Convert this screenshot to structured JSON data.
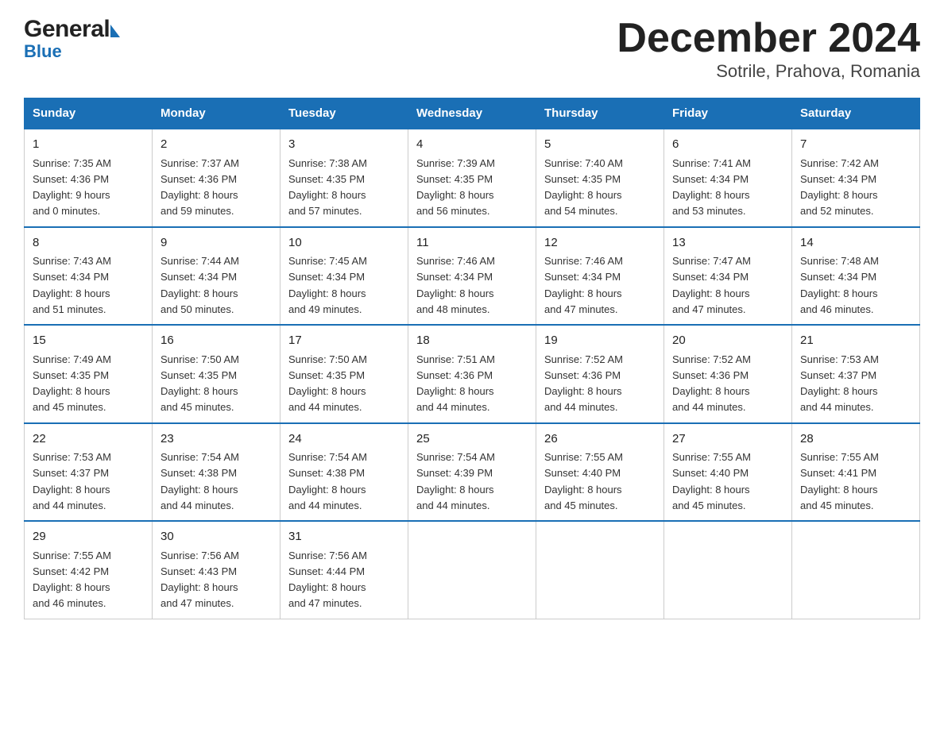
{
  "header": {
    "logo_general": "General",
    "logo_blue": "Blue",
    "title": "December 2024",
    "subtitle": "Sotrile, Prahova, Romania"
  },
  "days_of_week": [
    "Sunday",
    "Monday",
    "Tuesday",
    "Wednesday",
    "Thursday",
    "Friday",
    "Saturday"
  ],
  "weeks": [
    [
      {
        "day": "1",
        "sunrise": "7:35 AM",
        "sunset": "4:36 PM",
        "daylight": "9 hours and 0 minutes."
      },
      {
        "day": "2",
        "sunrise": "7:37 AM",
        "sunset": "4:36 PM",
        "daylight": "8 hours and 59 minutes."
      },
      {
        "day": "3",
        "sunrise": "7:38 AM",
        "sunset": "4:35 PM",
        "daylight": "8 hours and 57 minutes."
      },
      {
        "day": "4",
        "sunrise": "7:39 AM",
        "sunset": "4:35 PM",
        "daylight": "8 hours and 56 minutes."
      },
      {
        "day": "5",
        "sunrise": "7:40 AM",
        "sunset": "4:35 PM",
        "daylight": "8 hours and 54 minutes."
      },
      {
        "day": "6",
        "sunrise": "7:41 AM",
        "sunset": "4:34 PM",
        "daylight": "8 hours and 53 minutes."
      },
      {
        "day": "7",
        "sunrise": "7:42 AM",
        "sunset": "4:34 PM",
        "daylight": "8 hours and 52 minutes."
      }
    ],
    [
      {
        "day": "8",
        "sunrise": "7:43 AM",
        "sunset": "4:34 PM",
        "daylight": "8 hours and 51 minutes."
      },
      {
        "day": "9",
        "sunrise": "7:44 AM",
        "sunset": "4:34 PM",
        "daylight": "8 hours and 50 minutes."
      },
      {
        "day": "10",
        "sunrise": "7:45 AM",
        "sunset": "4:34 PM",
        "daylight": "8 hours and 49 minutes."
      },
      {
        "day": "11",
        "sunrise": "7:46 AM",
        "sunset": "4:34 PM",
        "daylight": "8 hours and 48 minutes."
      },
      {
        "day": "12",
        "sunrise": "7:46 AM",
        "sunset": "4:34 PM",
        "daylight": "8 hours and 47 minutes."
      },
      {
        "day": "13",
        "sunrise": "7:47 AM",
        "sunset": "4:34 PM",
        "daylight": "8 hours and 47 minutes."
      },
      {
        "day": "14",
        "sunrise": "7:48 AM",
        "sunset": "4:34 PM",
        "daylight": "8 hours and 46 minutes."
      }
    ],
    [
      {
        "day": "15",
        "sunrise": "7:49 AM",
        "sunset": "4:35 PM",
        "daylight": "8 hours and 45 minutes."
      },
      {
        "day": "16",
        "sunrise": "7:50 AM",
        "sunset": "4:35 PM",
        "daylight": "8 hours and 45 minutes."
      },
      {
        "day": "17",
        "sunrise": "7:50 AM",
        "sunset": "4:35 PM",
        "daylight": "8 hours and 44 minutes."
      },
      {
        "day": "18",
        "sunrise": "7:51 AM",
        "sunset": "4:36 PM",
        "daylight": "8 hours and 44 minutes."
      },
      {
        "day": "19",
        "sunrise": "7:52 AM",
        "sunset": "4:36 PM",
        "daylight": "8 hours and 44 minutes."
      },
      {
        "day": "20",
        "sunrise": "7:52 AM",
        "sunset": "4:36 PM",
        "daylight": "8 hours and 44 minutes."
      },
      {
        "day": "21",
        "sunrise": "7:53 AM",
        "sunset": "4:37 PM",
        "daylight": "8 hours and 44 minutes."
      }
    ],
    [
      {
        "day": "22",
        "sunrise": "7:53 AM",
        "sunset": "4:37 PM",
        "daylight": "8 hours and 44 minutes."
      },
      {
        "day": "23",
        "sunrise": "7:54 AM",
        "sunset": "4:38 PM",
        "daylight": "8 hours and 44 minutes."
      },
      {
        "day": "24",
        "sunrise": "7:54 AM",
        "sunset": "4:38 PM",
        "daylight": "8 hours and 44 minutes."
      },
      {
        "day": "25",
        "sunrise": "7:54 AM",
        "sunset": "4:39 PM",
        "daylight": "8 hours and 44 minutes."
      },
      {
        "day": "26",
        "sunrise": "7:55 AM",
        "sunset": "4:40 PM",
        "daylight": "8 hours and 45 minutes."
      },
      {
        "day": "27",
        "sunrise": "7:55 AM",
        "sunset": "4:40 PM",
        "daylight": "8 hours and 45 minutes."
      },
      {
        "day": "28",
        "sunrise": "7:55 AM",
        "sunset": "4:41 PM",
        "daylight": "8 hours and 45 minutes."
      }
    ],
    [
      {
        "day": "29",
        "sunrise": "7:55 AM",
        "sunset": "4:42 PM",
        "daylight": "8 hours and 46 minutes."
      },
      {
        "day": "30",
        "sunrise": "7:56 AM",
        "sunset": "4:43 PM",
        "daylight": "8 hours and 47 minutes."
      },
      {
        "day": "31",
        "sunrise": "7:56 AM",
        "sunset": "4:44 PM",
        "daylight": "8 hours and 47 minutes."
      },
      null,
      null,
      null,
      null
    ]
  ],
  "labels": {
    "sunrise": "Sunrise:",
    "sunset": "Sunset:",
    "daylight": "Daylight:"
  }
}
